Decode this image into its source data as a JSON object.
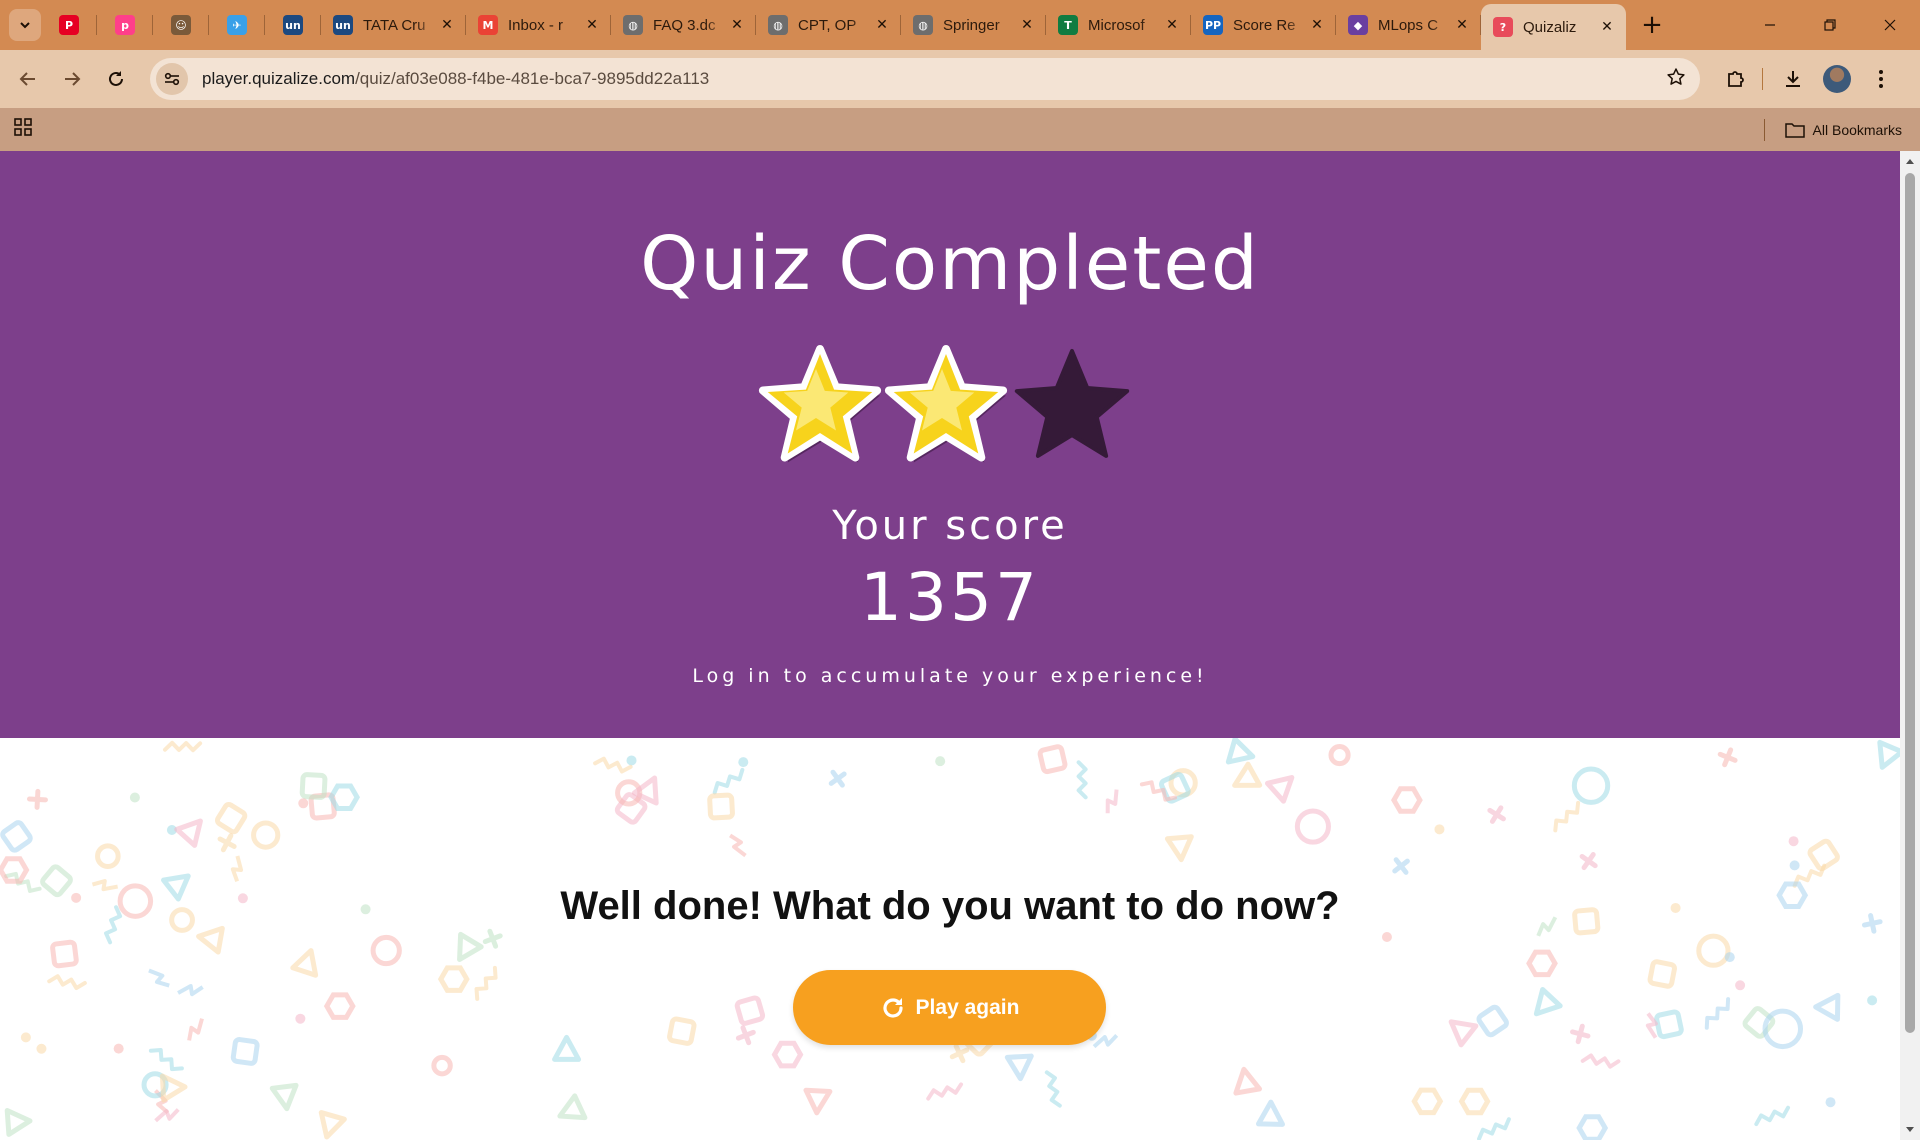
{
  "browser": {
    "pinned_tabs": [
      {
        "icon": "pinterest-icon",
        "color": "#e60023"
      },
      {
        "icon": "picsart-icon",
        "color": "#ff3e8a"
      },
      {
        "icon": "profile-doodle-icon",
        "color": "#7a5a3a"
      },
      {
        "icon": "bird-app-icon",
        "color": "#3aa0e8"
      },
      {
        "icon": "unstop-icon",
        "color": "#1c4980"
      }
    ],
    "tabs": [
      {
        "title": "TATA Cru",
        "icon": "unstop-icon",
        "color": "#1c4980"
      },
      {
        "title": "Inbox - r",
        "icon": "gmail-icon",
        "color": "#ea4335"
      },
      {
        "title": "FAQ 3.dc",
        "icon": "globe-icon",
        "color": "#6d6d6d"
      },
      {
        "title": "CPT, OP",
        "icon": "globe-icon",
        "color": "#6d6d6d"
      },
      {
        "title": "Springer",
        "icon": "globe-icon",
        "color": "#6d6d6d"
      },
      {
        "title": "Microsof",
        "icon": "ms-teams-icon",
        "color": "#107c41"
      },
      {
        "title": "Score Re",
        "icon": "pp-icon",
        "color": "#1565c0"
      },
      {
        "title": "MLops C",
        "icon": "mlops-icon",
        "color": "#6a3fa0"
      },
      {
        "title": "Quizaliz",
        "icon": "quizalize-icon",
        "color": "#e84b5a",
        "active": true
      }
    ],
    "url_domain": "player.quizalize.com",
    "url_path": "/quiz/af03e088-f4be-481e-bca7-9895dd22a113",
    "bookmarks_label": "All Bookmarks"
  },
  "quiz": {
    "title": "Quiz Completed",
    "stars_earned": 2,
    "stars_total": 3,
    "score_label": "Your score",
    "score_value": "1357",
    "login_message": "Log in to accumulate your experience!",
    "lower_heading": "Well done! What do you want to do now?",
    "play_again_label": "Play again",
    "colors": {
      "hero_background": "#7d3f8b",
      "star_filled": "#f7d31c",
      "star_empty": "#351a38",
      "button": "#f7a01f"
    }
  }
}
